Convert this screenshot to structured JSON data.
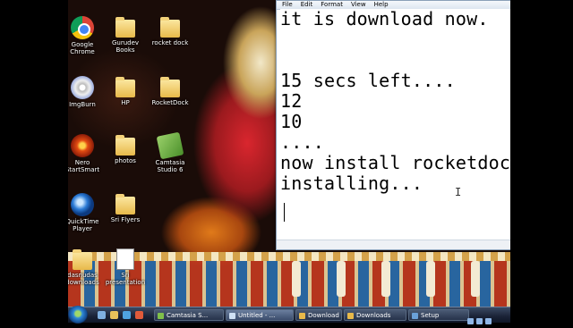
{
  "desktop": {
    "icons": [
      {
        "label_lines": [
          "Google",
          "Chrome"
        ],
        "icon": "chrome-icon"
      },
      {
        "label_lines": [
          "Gurudev",
          "Books"
        ],
        "icon": "folder-icon"
      },
      {
        "label_lines": [
          "rocket dock"
        ],
        "icon": "folder-icon"
      },
      {
        "label_lines": [
          "ImgBurn"
        ],
        "icon": "disc-icon"
      },
      {
        "label_lines": [
          "HP"
        ],
        "icon": "folder-icon"
      },
      {
        "label_lines": [
          "RocketDock"
        ],
        "icon": "folder-icon"
      },
      {
        "label_lines": [
          "Nero",
          "StartSmart"
        ],
        "icon": "nero-icon"
      },
      {
        "label_lines": [
          "photos"
        ],
        "icon": "folder-icon"
      },
      {
        "label_lines": [
          "Camtasia",
          "Studio 6"
        ],
        "icon": "camtasia-icon"
      },
      {
        "label_lines": [
          "QuickTime",
          "Player"
        ],
        "icon": "quicktime-icon"
      },
      {
        "label_lines": [
          "Sri Flyers"
        ],
        "icon": "folder-icon"
      },
      {
        "label_lines": [
          "dasnudas",
          "downloads"
        ],
        "icon": "folder-icon"
      },
      {
        "label_lines": [
          "Sri",
          "presentation"
        ],
        "icon": "document-icon"
      }
    ]
  },
  "notepad": {
    "menu": [
      "File",
      "Edit",
      "Format",
      "View",
      "Help"
    ],
    "lines": [
      "it is download now.",
      "",
      "",
      "15 secs left....",
      "12",
      "10",
      "....",
      "now install rocketdock",
      "installing..."
    ]
  },
  "taskbar": {
    "tasks": [
      {
        "label": "Camtasia S...",
        "color": "#7fc04a",
        "active": false
      },
      {
        "label": "Untitled - ...",
        "color": "#cfe1f5",
        "active": true
      },
      {
        "label": "Download ...",
        "color": "#e8b94a",
        "active": false
      },
      {
        "label": "Downloads",
        "color": "#e8b94a",
        "active": false
      },
      {
        "label": "Setup",
        "color": "#6aa0d8",
        "active": false
      }
    ]
  }
}
